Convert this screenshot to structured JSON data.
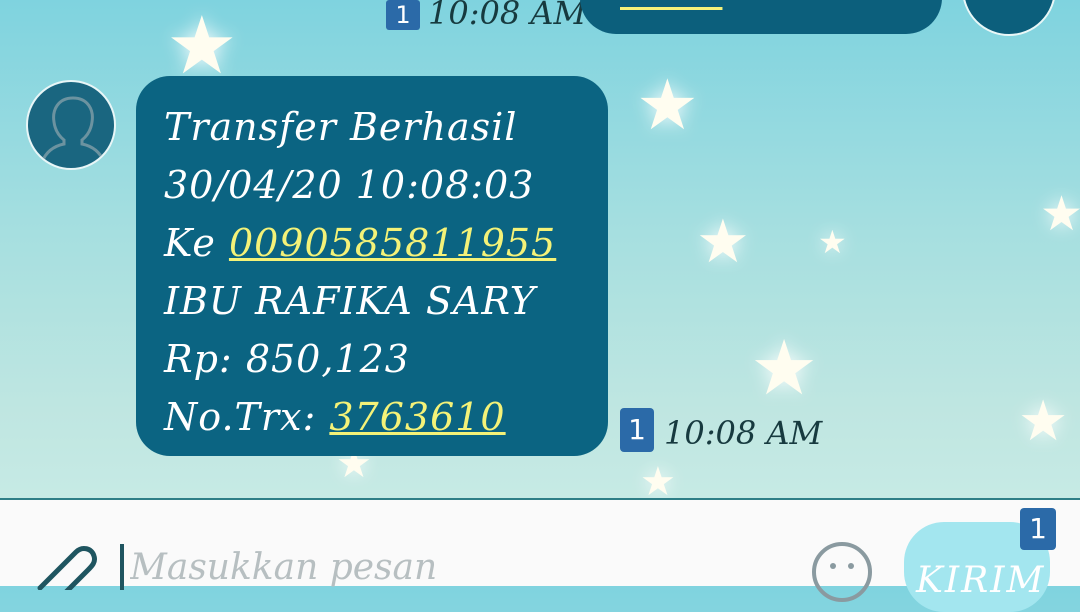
{
  "top_message": {
    "unread_badge": "1",
    "time": "10:08 AM"
  },
  "message": {
    "lines": [
      "Transfer Berhasil",
      "30/04/20 10:08:03",
      "Ke ",
      "IBU RAFIKA  SARY",
      "Rp: 850,123",
      "No.Trx: "
    ],
    "account_number": "0090585811955",
    "trx_number": "3763610",
    "unread_badge": "1",
    "time": "10:08 AM"
  },
  "input": {
    "placeholder": "Masukkan pesan",
    "send_label": "KIRIM",
    "send_badge": "1"
  },
  "colors": {
    "bubble": "#0b6482",
    "link": "#f4f278",
    "badge": "#2b6aa8",
    "send_button": "#a3e6ef"
  },
  "icons": [
    "avatar-icon",
    "paperclip-icon",
    "emoji-icon"
  ]
}
